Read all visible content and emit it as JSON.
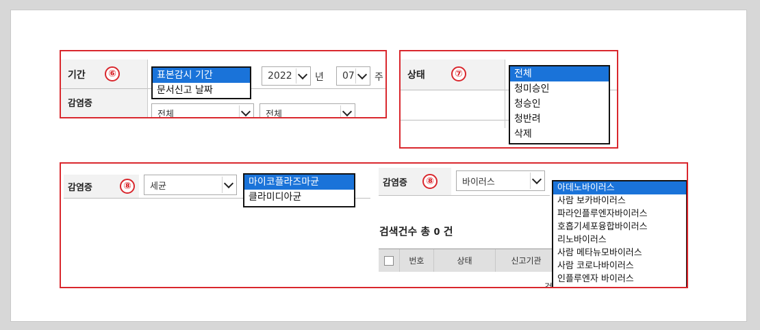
{
  "section6": {
    "label": "기간",
    "badge": "⑥",
    "period_options": [
      "표본감시 기간",
      "문서신고 날짜"
    ],
    "period_selected": "표본감시 기간",
    "year_value": "2022",
    "year_unit": "년",
    "week_value": "07",
    "week_unit": "주",
    "row2_label": "감염증",
    "row2_select1": "전체",
    "row2_select2": "전체"
  },
  "section7": {
    "label": "상태",
    "badge": "⑦",
    "status_options": [
      "전체",
      "청미승인",
      "청승인",
      "청반려",
      "삭제"
    ],
    "status_selected": "전체"
  },
  "section8_left": {
    "label": "감염증",
    "badge": "⑧",
    "category_value": "세균",
    "bacteria_options": [
      "마이코플라즈마균",
      "클라미디아균"
    ],
    "bacteria_selected": "마이코플라즈마균"
  },
  "section8_right": {
    "label": "감염증",
    "badge": "⑧",
    "category_value": "바이러스",
    "virus_options": [
      "아데노바이러스",
      "사람 보카바이러스",
      "파라인플루엔자바이러스",
      "호흡기세포융합바이러스",
      "리노바이러스",
      "사람 메타뉴모바이러스",
      "사람 코로나바이러스",
      "인플루엔자 바이러스"
    ],
    "virus_selected": "아데노바이러스",
    "search_count_prefix": "검색건수 총",
    "search_count": "0",
    "search_count_suffix": "건",
    "table_headers": [
      "번호",
      "상태",
      "신고기관"
    ],
    "partial_text": "검"
  },
  "colors": {
    "highlight_border": "#d9262c",
    "selected_option_bg": "#1a73d9"
  }
}
